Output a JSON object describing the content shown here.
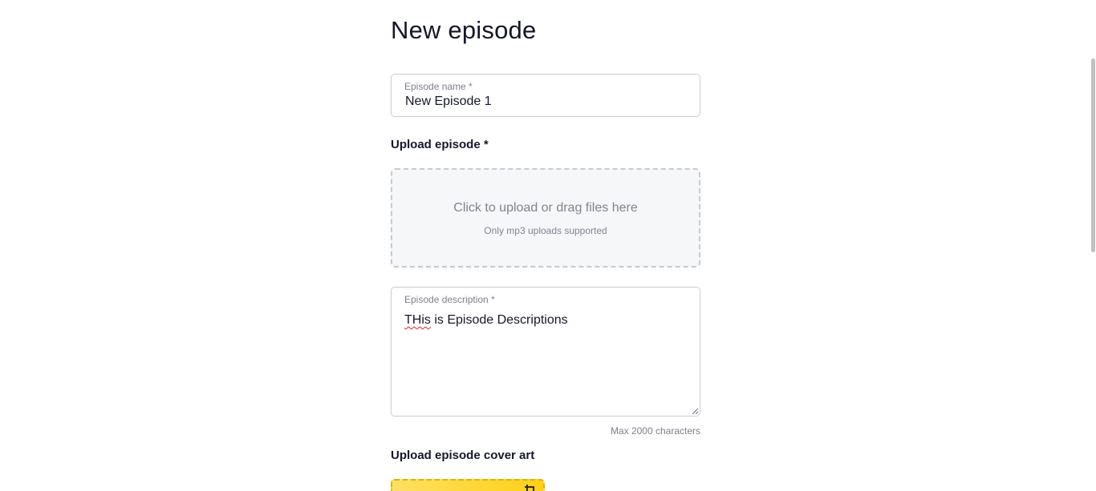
{
  "page": {
    "title": "New episode"
  },
  "episode_name": {
    "label": "Episode name *",
    "value": "New Episode 1"
  },
  "upload_episode": {
    "label": "Upload episode *",
    "dropzone_text": "Click to upload or drag files here",
    "dropzone_hint": "Only mp3 uploads supported"
  },
  "episode_description": {
    "label": "Episode description *",
    "value_misspelled": "THis",
    "value_rest": " is Episode Descriptions",
    "limit_hint": "Max 2000 characters"
  },
  "cover_art": {
    "label": "Upload episode cover art",
    "icon": "crop-icon",
    "color": "#ffd633"
  },
  "colors": {
    "text": "#15182b",
    "muted": "#7b7f8a",
    "border": "#c9ccd3",
    "dropzone_bg": "#f6f7f9"
  }
}
